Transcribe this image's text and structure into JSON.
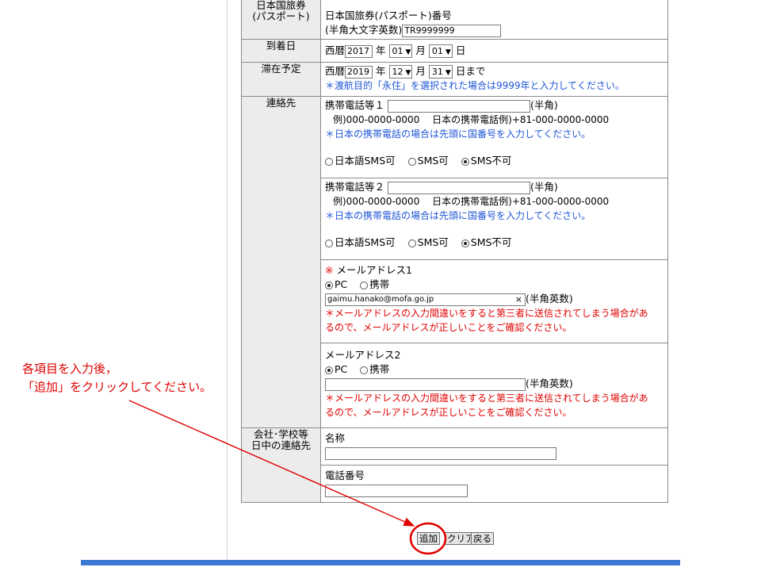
{
  "passport": {
    "label_line1": "日本国旅券",
    "label_line2": "(パスポート)",
    "line1": "日本国旅券(パスポート)番号",
    "line2": "(半角大文字英数)",
    "value": "TR9999999"
  },
  "arrival": {
    "label": "到着日",
    "era": "西暦",
    "year": "2017",
    "year_unit": "年",
    "month": "01",
    "month_unit": "月",
    "day": "01",
    "day_unit": "日"
  },
  "stay": {
    "label": "滞在予定",
    "era": "西暦",
    "year": "2019",
    "year_unit": "年",
    "month": "12",
    "month_unit": "月",
    "day": "31",
    "day_unit": "日まで",
    "note": "＊渡航目的「永住」を選択された場合は9999年と入力してください。"
  },
  "contact": {
    "label": "連絡先",
    "phone1": {
      "label": "携帯電話等１",
      "suffix": "(半角)",
      "value": "",
      "example": "例)000-0000-0000　 日本の携帯電話例)+81-000-0000-0000",
      "note": "＊日本の携帯電話の場合は先頭に国番号を入力してください。",
      "options": [
        "日本語SMS可",
        "SMS可",
        "SMS不可"
      ],
      "selected": "SMS不可"
    },
    "phone2": {
      "label": "携帯電話等２",
      "suffix": "(半角)",
      "value": "",
      "example": "例)000-0000-0000　 日本の携帯電話例)+81-000-0000-0000",
      "note": "＊日本の携帯電話の場合は先頭に国番号を入力してください。",
      "options": [
        "日本語SMS可",
        "SMS可",
        "SMS不可"
      ],
      "selected": "SMS不可"
    },
    "email1": {
      "required_mark": "※",
      "label": "メールアドレス1",
      "options": [
        "PC",
        "携帯"
      ],
      "selected": "PC",
      "value": "gaimu.hanako@mofa.go.jp",
      "clear": "×",
      "suffix": "(半角英数)",
      "warning_line1": "＊メールアドレスの入力間違いをすると第三者に送信されてしまう場合があ",
      "warning_line2": "るので、メールアドレスが正しいことをご確認ください。"
    },
    "email2": {
      "label": "メールアドレス2",
      "options": [
        "PC",
        "携帯"
      ],
      "selected": "PC",
      "value": "",
      "suffix": "(半角英数)",
      "warning_line1": "＊メールアドレスの入力間違いをすると第三者に送信されてしまう場合があ",
      "warning_line2": "るので、メールアドレスが正しいことをご確認ください。"
    }
  },
  "company": {
    "label_line1": "会社･学校等",
    "label_line2": "日中の連絡先",
    "name_label": "名称",
    "name_value": "",
    "phone_label": "電話番号",
    "phone_value": ""
  },
  "buttons": {
    "add": "追加",
    "clear": "クリア",
    "back": "戻る"
  },
  "annotation": {
    "line1": "各項目を入力後，",
    "line2": "「追加」をクリックしてください。"
  },
  "colors": {
    "note_blue": "#1f56d6",
    "warning_red": "#e00000",
    "annotation_red": "#e00000",
    "bottom_bar": "#3b78d4"
  }
}
